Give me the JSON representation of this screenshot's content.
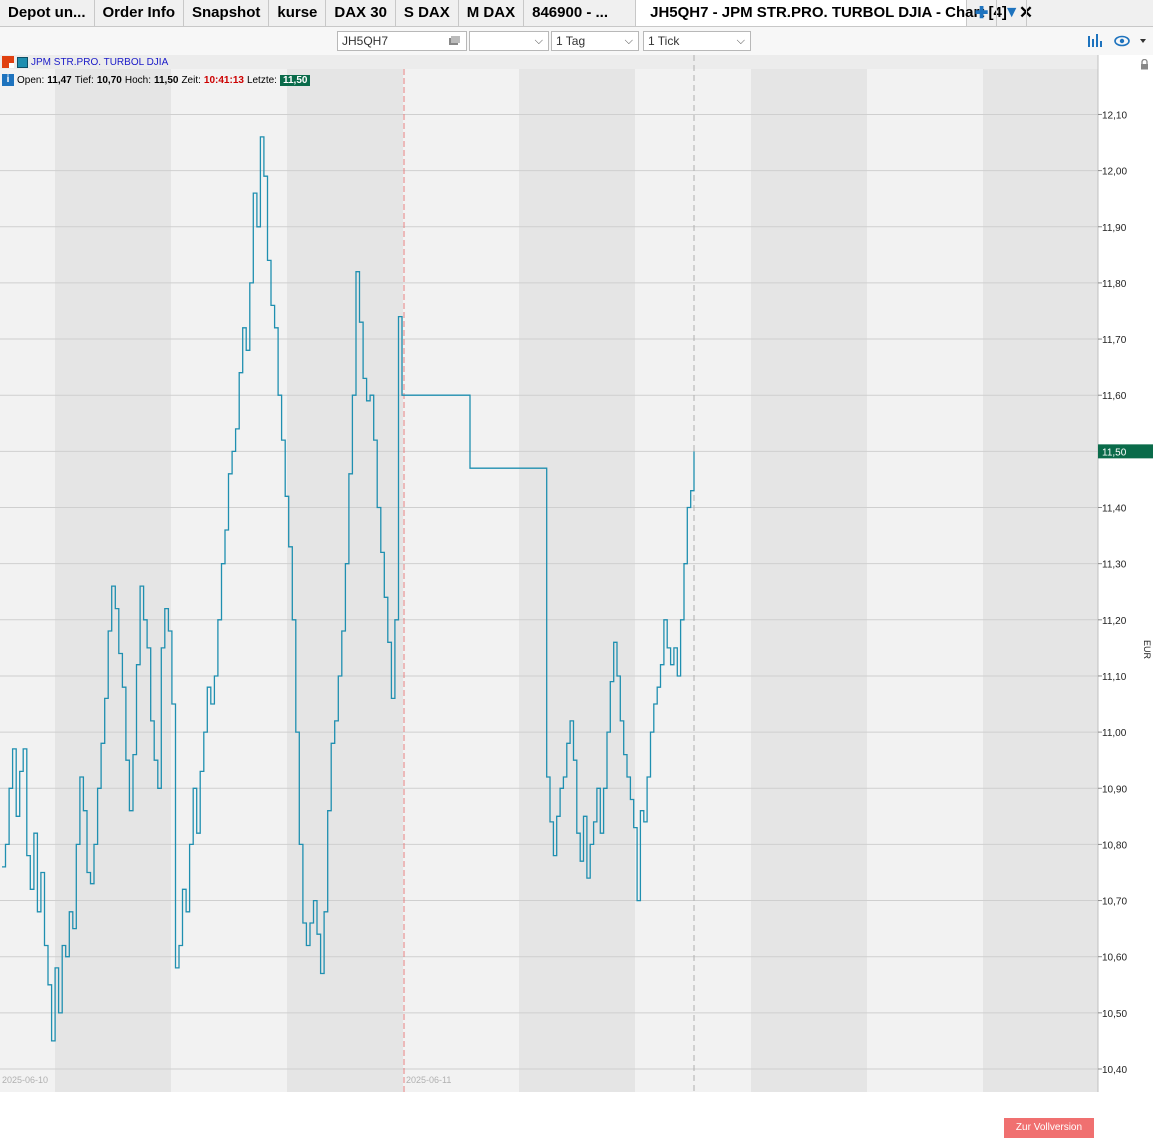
{
  "tabs": [
    {
      "label": "Depot un..."
    },
    {
      "label": "Order Info"
    },
    {
      "label": "Snapshot"
    },
    {
      "label": "kurse"
    },
    {
      "label": "DAX 30"
    },
    {
      "label": "S DAX"
    },
    {
      "label": "M DAX"
    },
    {
      "label": "846900 - ..."
    }
  ],
  "active_tab": {
    "label": "JH5QH7 - JPM STR.PRO. TURBOL DJIA - Chart [4]",
    "icon": "chart-tab-icon"
  },
  "tab_actions": {
    "add": "add-tab-icon",
    "menu": "chevron-down-icon",
    "close": "close-icon"
  },
  "toolbar": {
    "symbol": "JH5QH7",
    "blank_select": "",
    "period": "1 Tag",
    "interval": "1 Tick"
  },
  "instrument": {
    "name": "JPM STR.PRO. TURBOL DJIA"
  },
  "quote": {
    "open_label": "Open:",
    "open": "11,47",
    "low_label": "Tief:",
    "low": "10,70",
    "high_label": "Hoch:",
    "high": "11,50",
    "time_label": "Zeit:",
    "time": "10:41:13",
    "last_label": "Letzte:",
    "last": "11,50"
  },
  "colors": {
    "line": "#1f8fb0",
    "last_badge": "#0a6b4a",
    "time_text": "#cc0000",
    "vollversion": "#f07070",
    "session_line": "#e58080"
  },
  "button": {
    "vollversion": "Zur Vollversion"
  },
  "chart_data": {
    "type": "line",
    "ylabel": "EUR",
    "ylim": [
      10.4,
      12.14
    ],
    "yticks": [
      "12,10",
      "12,00",
      "11,90",
      "11,80",
      "11,70",
      "11,60",
      "11,50",
      "11,40",
      "11,30",
      "11,20",
      "11,10",
      "11,00",
      "10,90",
      "10,80",
      "10,70",
      "10,60",
      "10,50",
      "10,40"
    ],
    "ytick_values": [
      12.1,
      12.0,
      11.9,
      11.8,
      11.7,
      11.6,
      11.5,
      11.4,
      11.3,
      11.2,
      11.1,
      11.0,
      10.9,
      10.8,
      10.7,
      10.6,
      10.5,
      10.4
    ],
    "x_date_labels": [
      "2025-06-10",
      "2025-06-11"
    ],
    "last_price_label": "11,50",
    "last_price": 11.5,
    "grid": true,
    "series": [
      {
        "values": [
          10.76,
          10.8,
          10.9,
          10.97,
          10.85,
          10.93,
          10.97,
          10.78,
          10.72,
          10.82,
          10.68,
          10.75,
          10.62,
          10.55,
          10.45,
          10.58,
          10.5,
          10.62,
          10.6,
          10.68,
          10.65,
          10.8,
          10.92,
          10.86,
          10.75,
          10.73,
          10.8,
          10.9,
          10.98,
          11.06,
          11.18,
          11.26,
          11.22,
          11.14,
          11.08,
          10.95,
          10.86,
          10.96,
          11.12,
          11.26,
          11.2,
          11.15,
          11.02,
          10.95,
          10.9,
          11.15,
          11.22,
          11.18,
          11.05,
          10.58,
          10.62,
          10.72,
          10.68,
          10.8,
          10.9,
          10.82,
          10.93,
          11.0,
          11.08,
          11.05,
          11.1,
          11.2,
          11.3,
          11.36,
          11.46,
          11.5,
          11.54,
          11.64,
          11.72,
          11.68,
          11.8,
          11.96,
          11.9,
          12.06,
          11.99,
          11.84,
          11.76,
          11.72,
          11.6,
          11.52,
          11.42,
          11.33,
          11.2,
          11.0,
          10.8,
          10.66,
          10.62,
          10.66,
          10.7,
          10.64,
          10.57,
          10.68,
          10.86,
          10.98,
          11.02,
          11.1,
          11.18,
          11.3,
          11.46,
          11.6,
          11.82,
          11.73,
          11.63,
          11.59,
          11.6,
          11.52,
          11.4,
          11.32,
          11.24,
          11.16,
          11.06,
          11.2,
          11.74,
          11.6,
          11.47,
          11.47,
          11.47,
          10.92,
          10.84,
          10.78,
          10.85,
          10.9,
          10.92,
          10.98,
          11.02,
          10.95,
          10.82,
          10.77,
          10.85,
          10.74,
          10.8,
          10.84,
          10.9,
          10.82,
          10.9,
          11.0,
          11.09,
          11.16,
          11.1,
          11.02,
          10.96,
          10.92,
          10.88,
          10.83,
          10.7,
          10.86,
          10.84,
          10.92,
          11.0,
          11.05,
          11.08,
          11.12,
          11.2,
          11.15,
          11.12,
          11.15,
          11.1,
          11.2,
          11.3,
          11.4,
          11.43,
          11.5
        ]
      }
    ]
  }
}
